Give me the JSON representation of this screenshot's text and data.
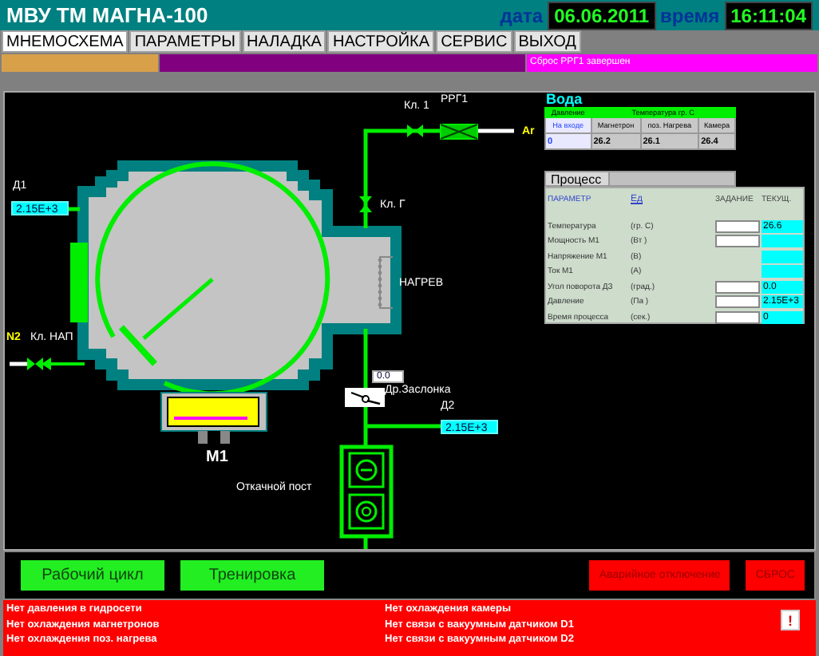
{
  "window": {
    "title": "МВУ ТМ МАГНА-100"
  },
  "clock": {
    "date_label": "дата",
    "date": "06.06.2011",
    "time_label": "время",
    "time": "16:11:04"
  },
  "tabs": [
    {
      "label": "МНЕМОСХЕМА",
      "selected": true
    },
    {
      "label": "ПАРАМЕТРЫ",
      "selected": false
    },
    {
      "label": "НАЛАДКА",
      "selected": false
    },
    {
      "label": "НАСТРОЙКА",
      "selected": false
    },
    {
      "label": "СЕРВИС",
      "selected": false
    },
    {
      "label": "ВЫХОД",
      "selected": false
    }
  ],
  "status_bar": [
    {
      "color": "#d9a04a"
    },
    {
      "color": "#800080"
    },
    {
      "color": "#ff00ff",
      "text": "Сброс РРГ1 завершен"
    }
  ],
  "diagram": {
    "d1_label": "Д1",
    "d1_value": "2.15E+3",
    "n2_label": "N2",
    "valve_nap": "Кл. НАП",
    "valve_1": "Кл. 1",
    "rrg1": "РРГ1",
    "ar_label": "Ar",
    "valve_g": "Кл. Г",
    "heater": "НАГРЕВ",
    "magnetron": "М1",
    "throttle_value": "0.0",
    "throttle_label": "Др.Заслонка",
    "d2_label": "Д2",
    "d2_value": "2.15E+3",
    "pump_station": "Откачной пост"
  },
  "water": {
    "title": "Вода",
    "group_headers": [
      "Давление",
      "Температура гр. С"
    ],
    "columns": [
      "На входе",
      "Магнетрон",
      "поз. Нагрева",
      "Камера"
    ],
    "values": [
      "0",
      "26.2",
      "26.1",
      "26.4"
    ]
  },
  "process": {
    "tab": "Процесс",
    "columns": [
      "ПАРАМЕТР",
      "Ед",
      "ЗАДАНИЕ",
      "ТЕКУЩ."
    ],
    "rows": [
      {
        "name": "Температура",
        "unit": "(гр. С)",
        "kind": "settable",
        "current": "26.6"
      },
      {
        "name": "Мощность М1",
        "unit": "(Вт )",
        "kind": "settable"
      },
      {
        "name": "Напряжение М1",
        "unit": "(В)",
        "kind": "readonly"
      },
      {
        "name": "Ток    М1",
        "unit": "(А)",
        "kind": "readonly"
      },
      {
        "name": "Угол поворота ДЗ",
        "unit": "(град.)",
        "kind": "settable",
        "current": "0.0"
      },
      {
        "name": "Давление",
        "unit": "(Па )",
        "kind": "settable",
        "current": "2.15E+3"
      },
      {
        "name": "Время процесса",
        "unit": "(сек.)",
        "kind": "settable",
        "current": "0"
      }
    ]
  },
  "buttons": [
    {
      "label": "Рабочий цикл",
      "kind": "mode"
    },
    {
      "label": "Тренировка",
      "kind": "mode"
    },
    {
      "label": "Аварийное отключение",
      "kind": "alarm"
    },
    {
      "label": "СБРОС",
      "kind": "alarm"
    }
  ],
  "alarms": [
    "Нет давления в гидросети",
    "Нет охлаждения магнетронов",
    "Нет охлаждения поз. нагрева",
    "Нет охлаждения камеры",
    "Нет связи с вакуумным датчиком D1",
    "Нет связи с вакуумным датчиком D2"
  ],
  "alarm_ack": "!"
}
